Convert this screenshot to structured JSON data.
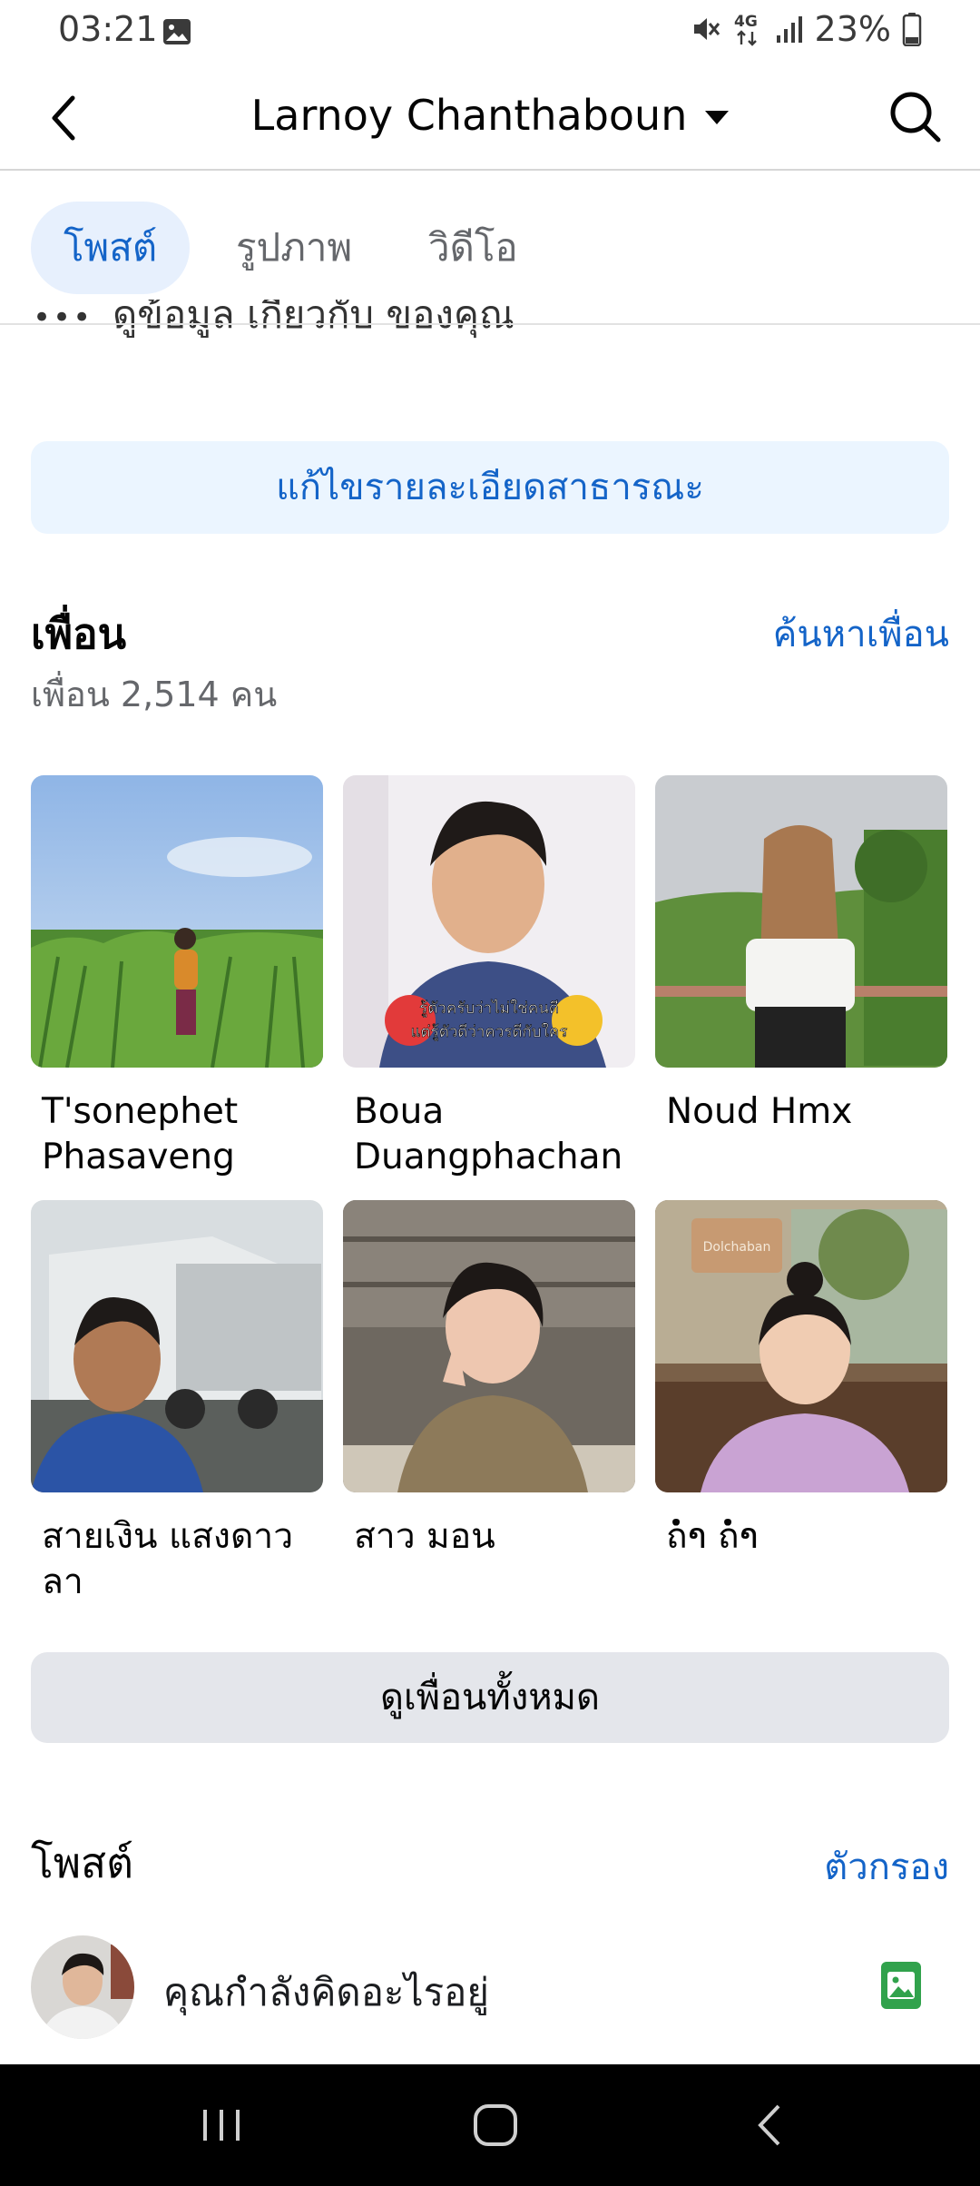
{
  "status_bar": {
    "time": "03:21",
    "battery": "23%",
    "network": "4G"
  },
  "header": {
    "title": "Larnoy Chanthaboun"
  },
  "tabs": [
    {
      "label": "โพสต์",
      "active": true
    },
    {
      "label": "รูปภาพ",
      "active": false
    },
    {
      "label": "วิดีโอ",
      "active": false
    }
  ],
  "about": {
    "partial_text": "ดูข้อมูล เกี่ยวกับ ของคุณ",
    "edit_button": "แก้ไขรายละเอียดสาธารณะ"
  },
  "friends": {
    "title": "เพื่อน",
    "count_text": "เพื่อน 2,514 คน",
    "find_link": "ค้นหาเพื่อน",
    "items": [
      {
        "name": "T'sonephet Phasaveng"
      },
      {
        "name": "Boua Duangphachan",
        "photo_caption_1": "รู้ตัวครับว่าไม่ใช่คนดี",
        "photo_caption_2": "แต่รู้ตัวดีว่าควรดีกับใคร"
      },
      {
        "name": "Noud Hmx"
      },
      {
        "name": "สายเงิน แสงดาวลา"
      },
      {
        "name": "สาว มอน"
      },
      {
        "name": "ถ່ຳ ถ່ຳ",
        "photo_sign": "Dolchaban"
      }
    ],
    "see_all": "ดูเพื่อนทั้งหมด"
  },
  "posts": {
    "title": "โพสต์",
    "filter_link": "ตัวกรอง",
    "composer_placeholder": "คุณกำลังคิดอะไรอยู่"
  },
  "colors": {
    "accent": "#1464c8",
    "tab_bg": "#e7f0fd",
    "edit_bg": "#ebf5ff",
    "secondary_btn": "#e4e6eb",
    "photo_icon": "#31a24c"
  }
}
